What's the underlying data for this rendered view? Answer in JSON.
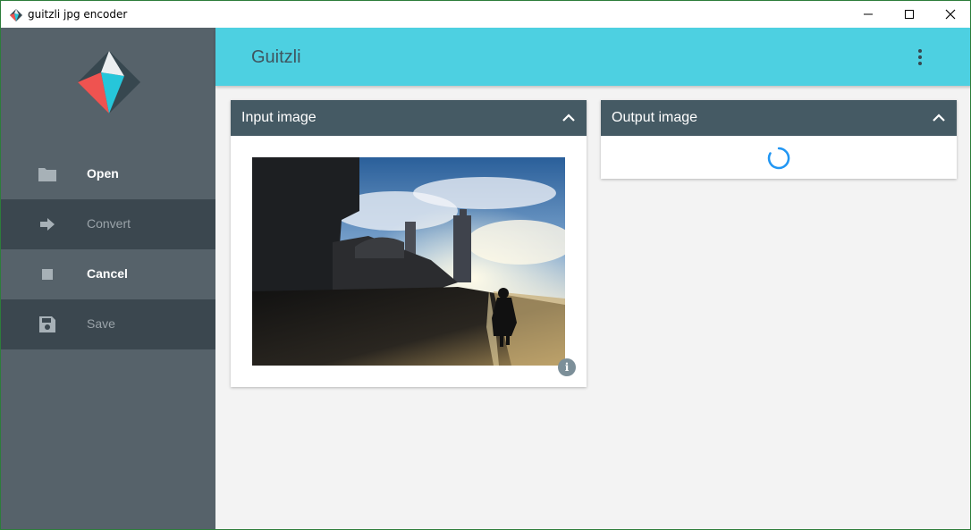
{
  "window": {
    "title": "guitzli jpg encoder"
  },
  "header": {
    "title": "Guitzli"
  },
  "sidebar": {
    "items": [
      {
        "label": "Open",
        "icon": "folder-icon",
        "enabled": true
      },
      {
        "label": "Convert",
        "icon": "arrow-right-icon",
        "enabled": false
      },
      {
        "label": "Cancel",
        "icon": "stop-icon",
        "enabled": true
      },
      {
        "label": "Save",
        "icon": "save-icon",
        "enabled": false
      }
    ]
  },
  "cards": {
    "input": {
      "title": "Input image",
      "info_glyph": "i"
    },
    "output": {
      "title": "Output image",
      "loading": true
    }
  },
  "colors": {
    "header_bg": "#4dd0e1",
    "sidebar_bg": "#56626a",
    "sidebar_disabled_bg": "#3b474f",
    "card_header_bg": "#455a64",
    "spinner": "#2196f3"
  }
}
